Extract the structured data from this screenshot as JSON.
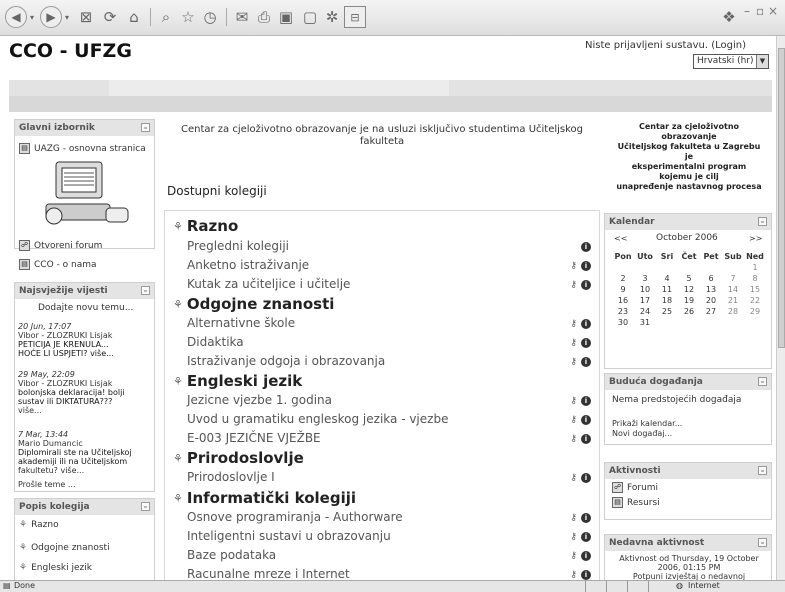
{
  "browser": {
    "status_text": "Done",
    "zone_text": "Internet"
  },
  "header": {
    "site_title": "CCO - UFZG",
    "login_status": "Niste prijavljeni sustavu. (Login)",
    "language": "Hrvatski (hr)"
  },
  "main_menu": {
    "title": "Glavni izbornik",
    "items": [
      "UAZG - osnovna stranica",
      "Otvoreni forum",
      "CCO - o nama"
    ]
  },
  "news": {
    "title": "Najsvježije vijesti",
    "add_topic": "Dodajte novu temu...",
    "posts": [
      {
        "date": "20 Jun, 17:07",
        "author": "Vibor - ZLOZRUKI Lisjak",
        "line1": "PETICIJA JE KRENULA...",
        "line2": "HOĆE LI USPJETI? više..."
      },
      {
        "date": "29 May, 22:09",
        "author": "Vibor - ZLOZRUKI Lisjak",
        "line1": "bolonjska deklaracija! bolji",
        "line2": "sustav ili DIKTATURA???",
        "line3": "više..."
      },
      {
        "date": "7 Mar, 13:44",
        "author": "Mario Dumancic",
        "line1": "Diplomirali ste na Učiteljskoj",
        "line2": "akademiji ili na Učiteljskom",
        "line3": "fakultetu? više..."
      }
    ],
    "older": "Prošle teme ..."
  },
  "course_index": {
    "title": "Popis kolegija",
    "items": [
      "Razno",
      "Odgojne znanosti",
      "Engleski jezik"
    ]
  },
  "center": {
    "intro": "Centar za cjeloživotno obrazovanje je na usluzi isključivo studentima Učiteljskog fakulteta",
    "heading": "Dostupni kolegiji",
    "categories": [
      {
        "name": "Razno",
        "courses": [
          "Pregledni kolegiji",
          "Anketno istraživanje",
          "Kutak za učiteljice i učitelje"
        ]
      },
      {
        "name": "Odgojne znanosti",
        "courses": [
          "Alternativne škole",
          "Didaktika",
          "Istraživanje odgoja i obrazovanja"
        ]
      },
      {
        "name": "Engleski jezik",
        "courses": [
          "Jezicne vjezbe 1. godina",
          "Uvod u gramatiku engleskog jezika - vjezbe",
          "E-003 JEZIČNE VJEŽBE"
        ]
      },
      {
        "name": "Prirodoslovlje",
        "courses": [
          "Prirodoslovlje I"
        ]
      },
      {
        "name": "Informatički kolegiji",
        "courses": [
          "Osnove programiranja - Authorware",
          "Inteligentni sustavi u obrazovanju",
          "Baze podataka",
          "Racunalne mreze i Internet"
        ]
      }
    ]
  },
  "right": {
    "blurb": [
      "Centar za cjeloživotno",
      "obrazovanje",
      "Učiteljskog fakulteta u Zagrebu",
      "je",
      "eksperimentalni program",
      "kojemu je cilj",
      "unapređenje nastavnog procesa"
    ],
    "calendar": {
      "title": "Kalendar",
      "prev": "<<",
      "next": ">>",
      "month": "October 2006",
      "weekdays": [
        "Pon",
        "Uto",
        "Sri",
        "Čet",
        "Pet",
        "Sub",
        "Ned"
      ],
      "weeks": [
        [
          "",
          "",
          "",
          "",
          "",
          "",
          "1"
        ],
        [
          "2",
          "3",
          "4",
          "5",
          "6",
          "7",
          "8"
        ],
        [
          "9",
          "10",
          "11",
          "12",
          "13",
          "14",
          "15"
        ],
        [
          "16",
          "17",
          "18",
          "19",
          "20",
          "21",
          "22"
        ],
        [
          "23",
          "24",
          "25",
          "26",
          "27",
          "28",
          "29"
        ],
        [
          "30",
          "31",
          "",
          "",
          "",
          "",
          ""
        ]
      ]
    },
    "upcoming": {
      "title": "Buduća događanja",
      "empty": "Nema predstojećih događaja",
      "link1": "Prikaži kalendar...",
      "link2": "Novi događaj..."
    },
    "activities": {
      "title": "Aktivnosti",
      "items": [
        "Forumi",
        "Resursi"
      ]
    },
    "recent": {
      "title": "Nedavna aktivnost",
      "line1": "Aktivnost od Thursday, 19 October",
      "line2": "2006, 01:15 PM",
      "line3": "Potpuni izvještaj o nedavnoj"
    }
  }
}
